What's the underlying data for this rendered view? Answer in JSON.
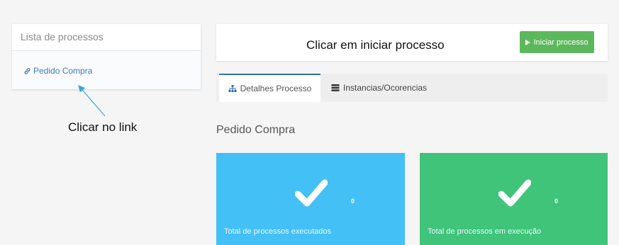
{
  "sidebar": {
    "title": "Lista de processos",
    "process_link": "Pedido Compra"
  },
  "annotations": {
    "click_link": "Clicar no link",
    "click_start": "Clicar em iniciar processo"
  },
  "toolbar": {
    "start_button": "Iniciar processo"
  },
  "tabs": [
    {
      "label": "Detalhes Processo",
      "icon": "sitemap-icon",
      "active": true
    },
    {
      "label": "Instancias/Ocorencias",
      "icon": "server-icon",
      "active": false
    }
  ],
  "main": {
    "title": "Pedido Compra",
    "cards": [
      {
        "count": "0",
        "label": "Total de processos executados",
        "color": "#43c0f5"
      },
      {
        "count": "0",
        "label": "Total de processos em execução",
        "color": "#3fc47a"
      }
    ]
  },
  "colors": {
    "accent": "#3c7bc4",
    "start_button": "#5cb85c",
    "annotation_arrow": "#3aa6d8"
  }
}
